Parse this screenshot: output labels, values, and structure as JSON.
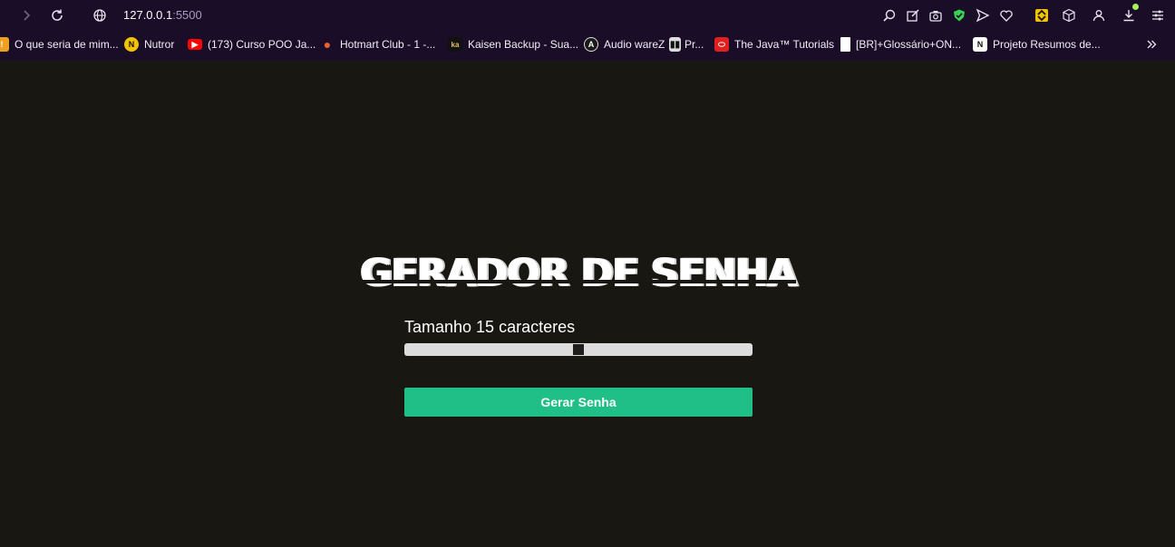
{
  "browser": {
    "url_host": "127.0.0.1",
    "url_port": ":5500",
    "bookmarks": [
      {
        "label": "O que seria de mim...",
        "icon": "warning-icon",
        "color": "#f0a020"
      },
      {
        "label": "Nutror",
        "icon": "nutror-icon",
        "color": "#f2c200"
      },
      {
        "label": "(173) Curso POO Ja...",
        "icon": "youtube-icon",
        "color": "#ff0000"
      },
      {
        "label": "Hotmart Club - 1 -...",
        "icon": "flame-icon",
        "color": "#f0602a"
      },
      {
        "label": "Kaisen Backup - Sua...",
        "icon": "kaisen-icon",
        "color": "#111111"
      },
      {
        "label": "Audio wareZ",
        "icon": "audio-icon",
        "color": "#1a1a1a"
      },
      {
        "label": "Pr...",
        "icon": "piano-icon",
        "color": "#dddddd"
      },
      {
        "label": "The Java™ Tutorials",
        "icon": "oracle-icon",
        "color": "#e02020"
      },
      {
        "label": "[BR]+Glossário+ON...",
        "icon": "document-icon",
        "color": "#ffffff"
      },
      {
        "label": "Projeto Resumos de...",
        "icon": "notion-icon",
        "color": "#ffffff"
      }
    ]
  },
  "app": {
    "title": "GERADOR DE SENHA",
    "size_label": "Tamanho 15 caracteres",
    "slider_fraction": 0.5,
    "button_label": "Gerar Senha",
    "accent_color": "#1fbf87",
    "background_color": "#181711"
  }
}
